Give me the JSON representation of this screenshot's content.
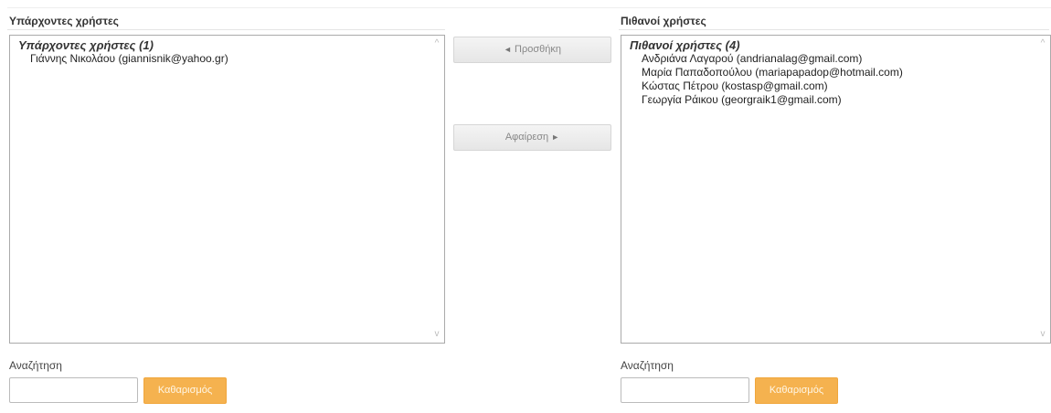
{
  "left_panel": {
    "heading": "Υπάρχοντες χρήστες",
    "group_label": "Υπάρχοντες χρήστες (1)",
    "options": [
      "Γιάννης Νικολάου (giannisnik@yahoo.gr)"
    ],
    "search_label": "Αναζήτηση",
    "search_value": "",
    "clear_label": "Καθαρισμός"
  },
  "right_panel": {
    "heading": "Πιθανοί χρήστες",
    "group_label": "Πιθανοί χρήστες (4)",
    "options": [
      "Ανδριάνα Λαγαρού (andrianalag@gmail.com)",
      "Μαρία Παπαδοπούλου (mariapapadop@hotmail.com)",
      "Κώστας Πέτρου (kostasp@gmail.com)",
      "Γεωργία Ράικου (georgraik1@gmail.com)"
    ],
    "search_label": "Αναζήτηση",
    "search_value": "",
    "clear_label": "Καθαρισμός"
  },
  "actions": {
    "add_icon": "◄",
    "add_label": "Προσθήκη",
    "remove_label": "Αφαίρεση",
    "remove_icon": "►"
  },
  "scroll_icons": {
    "up": "^",
    "down": "v"
  },
  "colors": {
    "accent": "#f5b24f",
    "border": "#aaaaaa"
  }
}
